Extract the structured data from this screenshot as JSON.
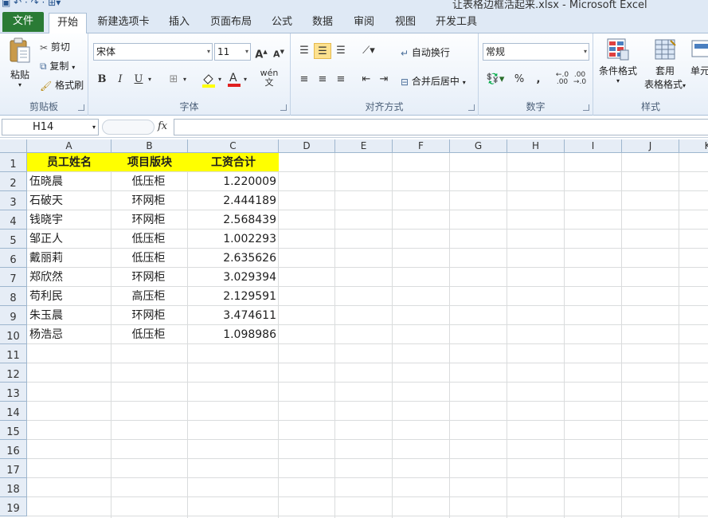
{
  "window": {
    "title": "让表格边框活起来.xlsx  -  Microsoft Excel"
  },
  "tabs": [
    "文件",
    "开始",
    "新建选项卡",
    "插入",
    "页面布局",
    "公式",
    "数据",
    "审阅",
    "视图",
    "开发工具"
  ],
  "ribbon": {
    "clipboard": {
      "label": "剪贴板",
      "paste": "粘贴",
      "cut": "剪切",
      "copy": "复制",
      "format_painter": "格式刷"
    },
    "font": {
      "label": "字体",
      "font_name": "宋体",
      "font_size": "11",
      "bold": "B",
      "italic": "I",
      "underline": "U",
      "phonetic": "wén 文"
    },
    "alignment": {
      "label": "对齐方式",
      "wrap_text": "自动换行",
      "merge_center": "合并后居中"
    },
    "number": {
      "label": "数字",
      "format": "常规",
      "percent": "%",
      "comma": ","
    },
    "styles": {
      "label": "样式",
      "conditional": "条件格式",
      "table_line1": "套用",
      "table_line2": "表格格式",
      "cell_styles": "单元"
    }
  },
  "formula_bar": {
    "name_box": "H14",
    "fx": "fx",
    "value": ""
  },
  "columns": [
    "A",
    "B",
    "C",
    "D",
    "E",
    "F",
    "G",
    "H",
    "I",
    "J",
    "K"
  ],
  "rows": [
    "1",
    "2",
    "3",
    "4",
    "5",
    "6",
    "7",
    "8",
    "9",
    "10",
    "11",
    "12",
    "13",
    "14",
    "15",
    "16",
    "17",
    "18",
    "19"
  ],
  "sheet": {
    "headers": [
      "员工姓名",
      "项目版块",
      "工资合计"
    ],
    "data": [
      [
        "伍晓晨",
        "低压柜",
        "1.220009"
      ],
      [
        "石破天",
        "环网柜",
        "2.444189"
      ],
      [
        "钱晓宇",
        "环网柜",
        "2.568439"
      ],
      [
        "邹正人",
        "低压柜",
        "1.002293"
      ],
      [
        "戴丽莉",
        "低压柜",
        "2.635626"
      ],
      [
        "郑欣然",
        "环网柜",
        "3.029394"
      ],
      [
        "苟利民",
        "高压柜",
        "2.129591"
      ],
      [
        "朱玉晨",
        "环网柜",
        "3.474611"
      ],
      [
        "杨浩忌",
        "低压柜",
        "1.098986"
      ]
    ]
  },
  "colors": {
    "file_tab": "#2a7b35",
    "header_fill": "#ffff00"
  }
}
